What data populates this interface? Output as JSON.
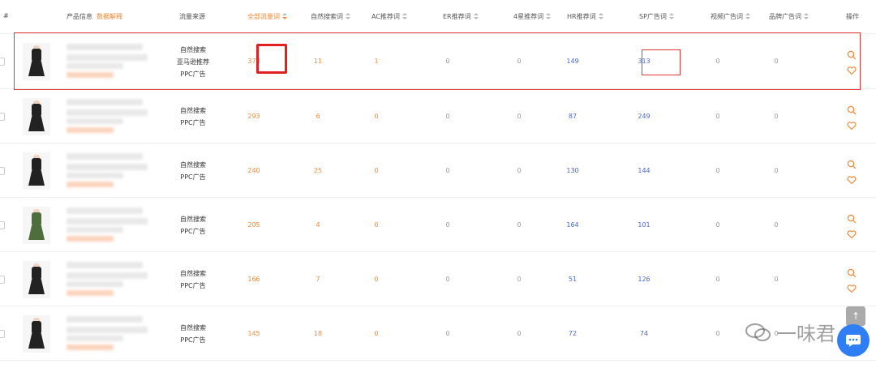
{
  "header": {
    "index": "#",
    "product_info": "产品信息",
    "data_explain": "数据解释",
    "traffic_source": "流量来源",
    "all_traffic": "全部流量词",
    "natural": "自然搜索词",
    "ac": "AC推荐词",
    "er": "ER推荐词",
    "four_star": "4星推荐词",
    "hr": "HR推荐词",
    "sp": "SP广告词",
    "video_ad": "视频广告词",
    "brand_ad": "品牌广告词",
    "actions": "操作"
  },
  "rows": [
    {
      "sources": [
        "自然搜索",
        "亚马逊推荐",
        "PPC广告"
      ],
      "all": "378",
      "natural": "11",
      "ac": "1",
      "er": "0",
      "four_star": "0",
      "hr": "149",
      "sp": "313",
      "video": "0",
      "brand": "0",
      "dress_color": "black"
    },
    {
      "sources": [
        "自然搜索",
        "PPC广告"
      ],
      "all": "293",
      "natural": "6",
      "ac": "0",
      "er": "0",
      "four_star": "0",
      "hr": "87",
      "sp": "249",
      "video": "0",
      "brand": "0",
      "dress_color": "black"
    },
    {
      "sources": [
        "自然搜索",
        "PPC广告"
      ],
      "all": "240",
      "natural": "25",
      "ac": "0",
      "er": "0",
      "four_star": "0",
      "hr": "130",
      "sp": "144",
      "video": "0",
      "brand": "0",
      "dress_color": "black"
    },
    {
      "sources": [
        "自然搜索",
        "PPC广告"
      ],
      "all": "205",
      "natural": "4",
      "ac": "0",
      "er": "0",
      "four_star": "0",
      "hr": "164",
      "sp": "101",
      "video": "0",
      "brand": "0",
      "dress_color": "green"
    },
    {
      "sources": [
        "自然搜索",
        "PPC广告"
      ],
      "all": "166",
      "natural": "7",
      "ac": "0",
      "er": "0",
      "four_star": "0",
      "hr": "51",
      "sp": "126",
      "video": "0",
      "brand": "0",
      "dress_color": "black"
    },
    {
      "sources": [
        "自然搜索",
        "PPC广告"
      ],
      "all": "145",
      "natural": "18",
      "ac": "0",
      "er": "0",
      "four_star": "0",
      "hr": "72",
      "sp": "74",
      "video": "0",
      "brand": "0",
      "dress_color": "black"
    }
  ],
  "watermark": "一味君",
  "scroll_top_glyph": "↑",
  "icons": {
    "search": "search-icon",
    "favorite": "heart-icon",
    "chat": "chat-icon"
  },
  "colors": {
    "accent": "#f08a3c",
    "blue": "#4a67d6",
    "highlight": "#e53935",
    "chat_button": "#2f7ef5"
  }
}
